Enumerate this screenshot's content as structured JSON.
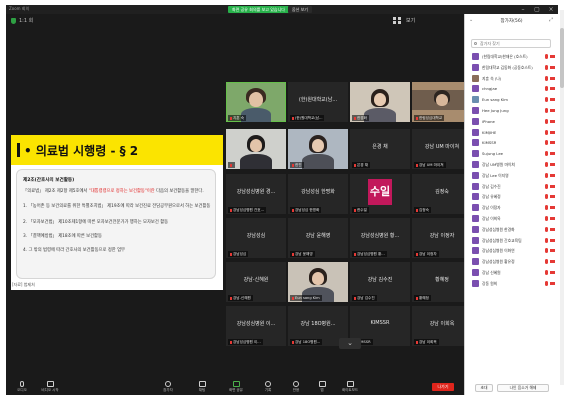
{
  "titlebar": {
    "app_name": "Zoom 회의",
    "share_badge": "화면 공유 회의를 보고 있습니다",
    "stop_label": "옵션 보기"
  },
  "meeting_bar": {
    "label": "1:1 회",
    "view_label": "보기",
    "fullscreen_label": ""
  },
  "shared_slide": {
    "title": "• 의료법 시행령 - § 2",
    "heading": "제2조(간호사의 보건활동)",
    "intro_plain": "「의료법」 제2조 제2항 제5호에서 ",
    "intro_red": "\"대통령령으로 정하는 보건활동\"이란",
    "intro_tail": " 다음의 보건활동을 말한다.",
    "items": [
      "1. 「농어촌 등 보건의료를 위한 특별조치법」 제19조에 따라 보건진료 전담공무원으로서 하는 보건활동",
      "2. 「모자보건법」 제10조제1항에 따른 모자보건전문가가 행하는 모자보건 활동",
      "3. 「결핵예방법」 제18조에 따른 보건활동",
      "4. 그 밖의 법령에 따라 간호사의 보건활동으로 정한 업무"
    ],
    "footer": "[자료] 법제처"
  },
  "tiles": [
    {
      "name": "",
      "tag": "지훈 숙",
      "video": true
    },
    {
      "name": "(한)원대학교(남...",
      "tag": "(한)원대학교(남...",
      "video": false
    },
    {
      "name": "",
      "tag": "한경화",
      "video": true
    },
    {
      "name": "",
      "tag": "한림성심대학교",
      "video": true
    },
    {
      "name": "",
      "tag": "",
      "video": true
    },
    {
      "name": "",
      "tag": "한진",
      "video": true
    },
    {
      "name": "은경 채",
      "tag": "은경 채",
      "video": false
    },
    {
      "name": "강남 UM 마이쳐",
      "tag": "강남 UM 마이쳐",
      "video": false
    },
    {
      "name": "강남성심병원 경...",
      "tag": "강남성심병원 간호...",
      "video": false
    },
    {
      "name": "강남성심 한명화",
      "tag": "강남성심 한명화",
      "video": false
    },
    {
      "name": "수일",
      "tag": "한수일",
      "video": false,
      "avatar": "수일"
    },
    {
      "name": "김정숙",
      "tag": "김정숙",
      "video": false
    },
    {
      "name": "강남성심",
      "tag": "강남성심",
      "video": false
    },
    {
      "name": "강남 윤해영",
      "tag": "강남 윤해영",
      "video": false
    },
    {
      "name": "강남성심병원 황...",
      "tag": "강남성심병원 황...",
      "video": false
    },
    {
      "name": "강남 이정자",
      "tag": "강남 이정자",
      "video": false
    },
    {
      "name": "강남-신혜원",
      "tag": "강남-신혜원",
      "video": false
    },
    {
      "name": "",
      "tag": "Eun sang Kim",
      "video": true
    },
    {
      "name": "강남 김수진",
      "tag": "강남 김수진",
      "video": false
    },
    {
      "name": "황혜정",
      "tag": "황혜정",
      "video": false
    },
    {
      "name": "강남성심병원 이...",
      "tag": "강남성심병원 이...",
      "video": false
    },
    {
      "name": "강남 18O병원...",
      "tag": "강남 18O병원...",
      "video": false
    },
    {
      "name": "KIMSSR",
      "tag": "KIMSSR",
      "video": false
    },
    {
      "name": "강남 이희옥",
      "tag": "강남 이희옥",
      "video": false
    }
  ],
  "pager": "⌄",
  "toolbar": {
    "items": [
      "오디오",
      "비디오 시작",
      "참가자",
      "채팅",
      "화면 공유",
      "기록",
      "반응",
      "앱",
      "화이트보드"
    ],
    "leave": "나가기"
  },
  "participants_panel": {
    "title": "참가자(56)",
    "search_placeholder": "참가자 찾기",
    "list": [
      "(한림대학교)한재은 (호스트)",
      "한림대학교 김동화 (공동호스트)",
      "지훈 숙 (나)",
      "chngjae",
      "Eun sang Kim",
      "Hee Jung Jung",
      "iPhone",
      "KIMJIHE",
      "KIMSSR",
      "Sujung Lee",
      "강남 UM병원 마이쳐",
      "강남 Lee 이지영",
      "강남 김수진",
      "강남 유혜정",
      "강남 이정자",
      "강남 이희옥",
      "강남성심병원 한경화",
      "강남성심병원 간호교육팀",
      "강남성심병원 이화연",
      "강남성심병원 황유정",
      "강남 신혜원",
      "강동 원희"
    ],
    "invite_label": "초대",
    "mute_all_label": "나인 음소거 해제"
  }
}
